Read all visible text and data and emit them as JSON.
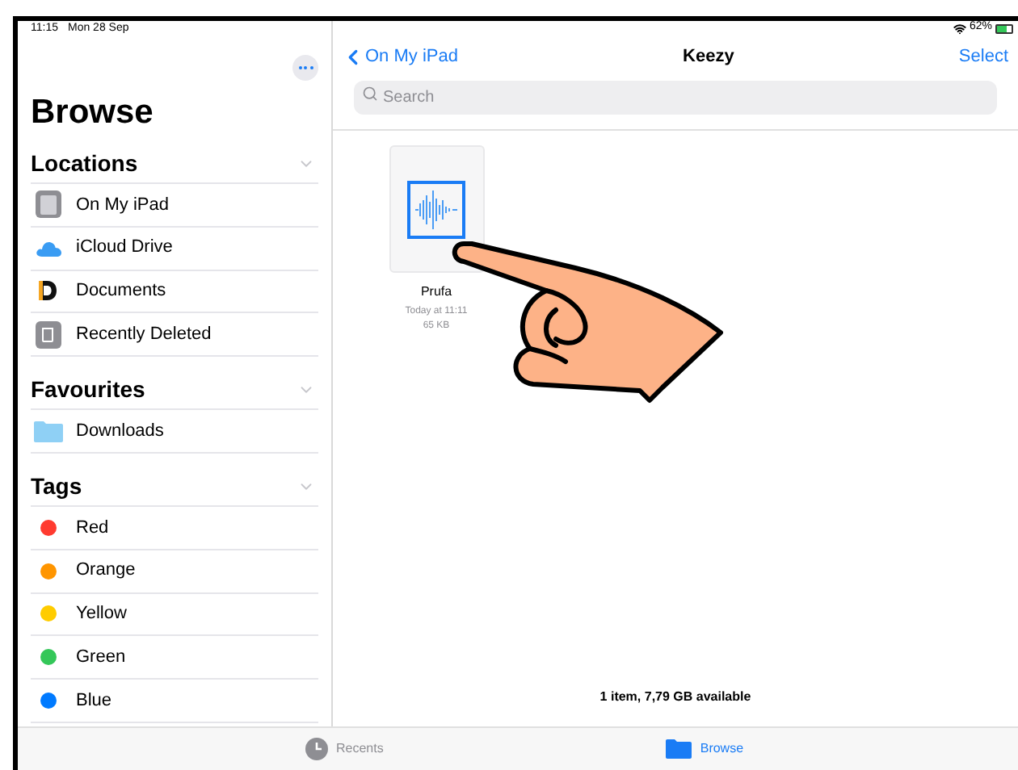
{
  "status_bar": {
    "time": "11:15",
    "date": "Mon 28 Sep",
    "battery": {
      "text": "62%",
      "level": 0.62
    }
  },
  "sidebar": {
    "title": "Browse",
    "sections": [
      {
        "title": "Locations",
        "items": [
          {
            "label": "On My iPad",
            "kind": "ipad"
          },
          {
            "label": "iCloud Drive",
            "kind": "cloud"
          },
          {
            "label": "Documents",
            "kind": "documents"
          },
          {
            "label": "Recently Deleted",
            "kind": "trash"
          }
        ]
      },
      {
        "title": "Favourites",
        "items": [
          {
            "label": "Downloads",
            "kind": "folder"
          }
        ]
      },
      {
        "title": "Tags",
        "items": [
          {
            "label": "Red",
            "kind": "tag",
            "color": "#ff3b30"
          },
          {
            "label": "Orange",
            "kind": "tag",
            "color": "#ff9500"
          },
          {
            "label": "Yellow",
            "kind": "tag",
            "color": "#ffcc00"
          },
          {
            "label": "Green",
            "kind": "tag",
            "color": "#34c759"
          },
          {
            "label": "Blue",
            "kind": "tag",
            "color": "#007aff"
          }
        ]
      }
    ]
  },
  "detail": {
    "back": "On My iPad",
    "title": "Keezy",
    "action": "Select",
    "search": {
      "placeholder": "Search"
    },
    "files": [
      {
        "name": "Prufa",
        "date": "Today at 11:11",
        "size": "65 KB"
      }
    ],
    "footer": "1 item, 7,79 GB available"
  },
  "tab_bar": [
    {
      "label": "Recents",
      "kind": "recents",
      "selected": false
    },
    {
      "label": "Browse",
      "kind": "browse",
      "selected": true
    }
  ]
}
